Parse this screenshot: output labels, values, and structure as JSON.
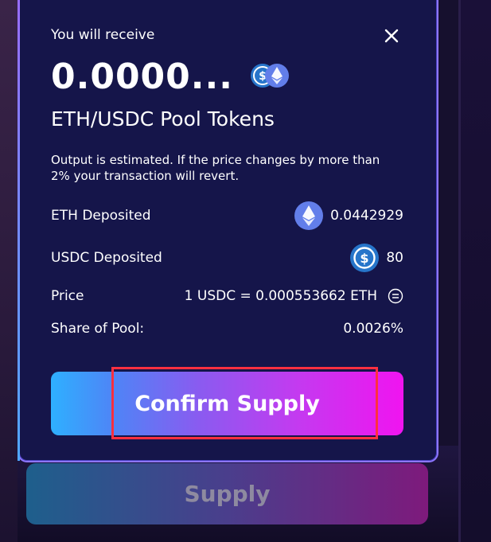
{
  "modal": {
    "receive_label": "You will receive",
    "amount": "0.0000...",
    "pool_tokens": "ETH/USDC Pool Tokens",
    "estimate_text": "Output is estimated. If the price changes by more than 2% your transaction will revert.",
    "rows": [
      {
        "label": "ETH Deposited",
        "value": "0.0442929",
        "icon": "eth-icon"
      },
      {
        "label": "USDC Deposited",
        "value": "80",
        "icon": "usdc-icon"
      },
      {
        "label": "Price",
        "value": "1 USDC = 0.000553662 ETH",
        "icon": "equal-icon"
      },
      {
        "label": "Share of Pool:",
        "value": "0.0026%"
      }
    ],
    "confirm_label": "Confirm Supply"
  },
  "background": {
    "supply_label": "Supply"
  },
  "colors": {
    "modal_bg": "#15154a",
    "eth_blue": "#627eea",
    "usdc_blue": "#2775ca",
    "highlight": "#ff3040"
  }
}
